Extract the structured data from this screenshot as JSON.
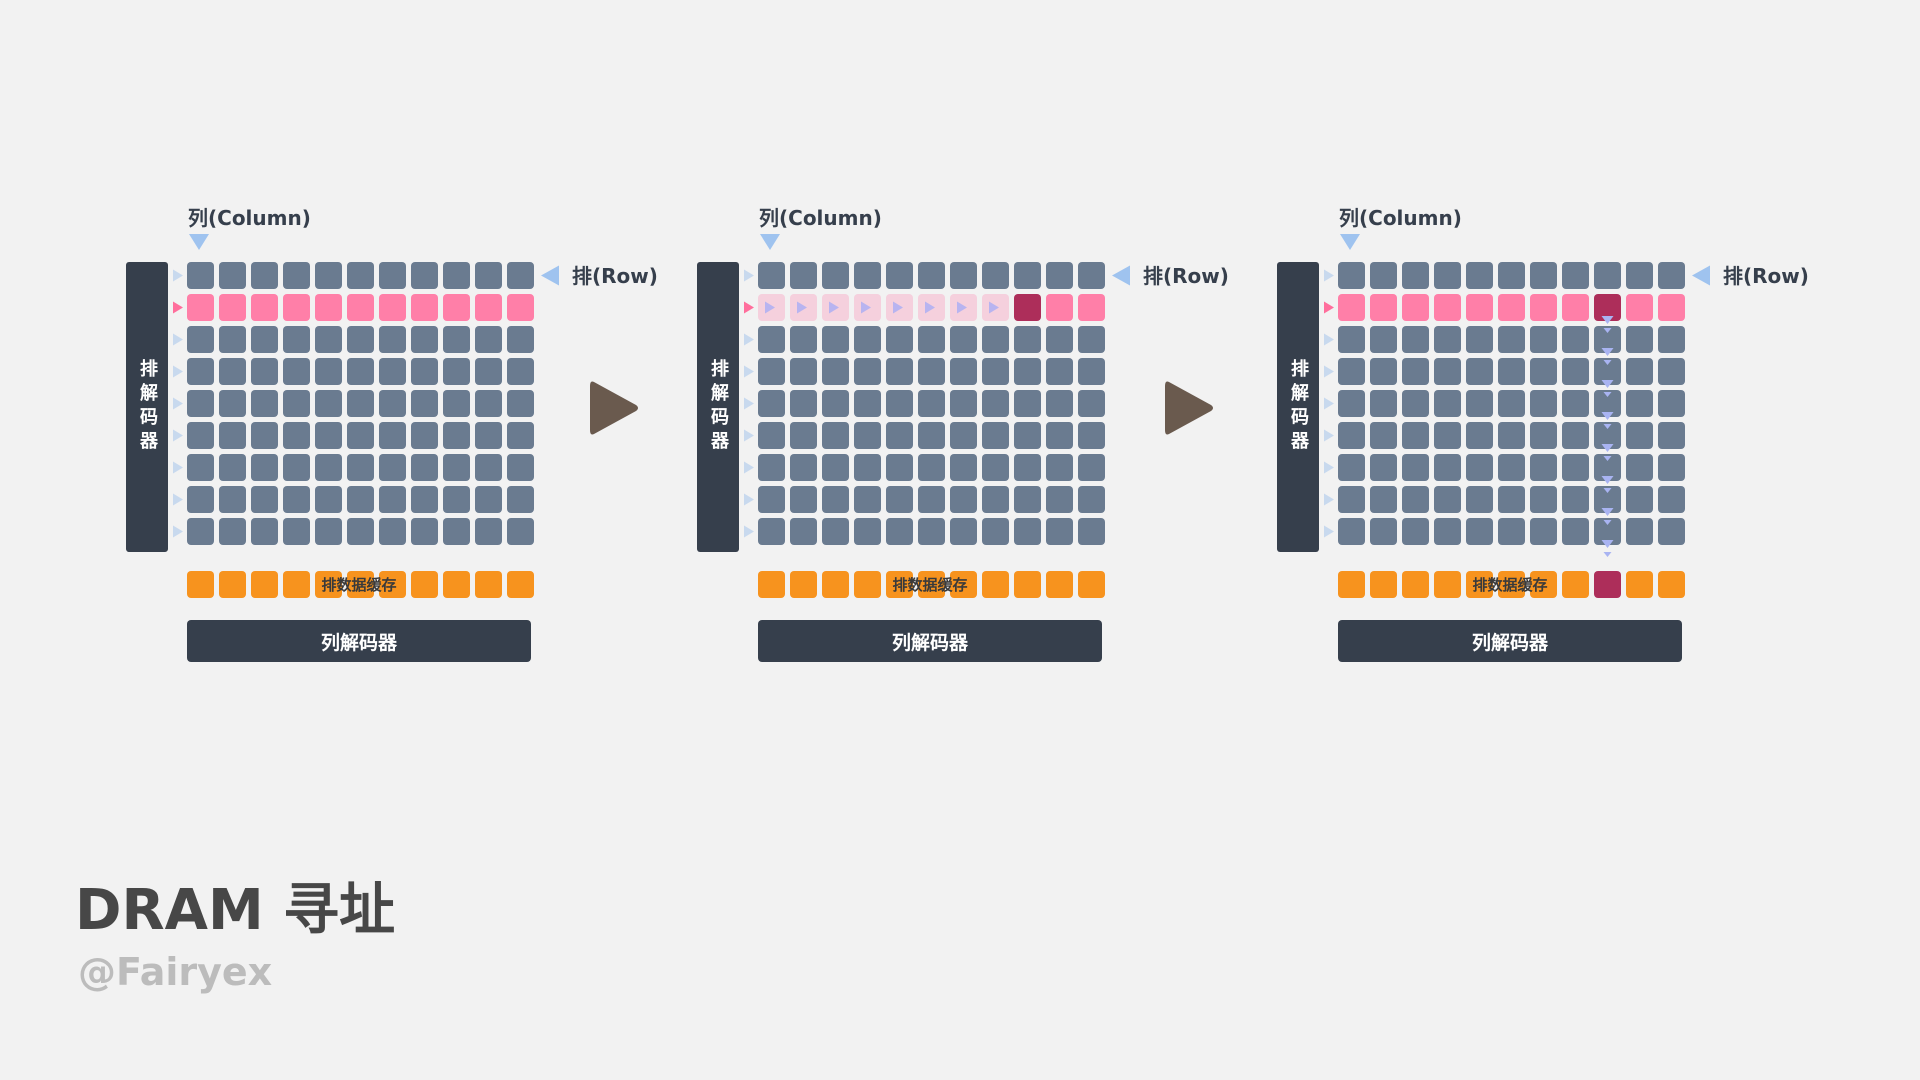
{
  "colors": {
    "background": "#f2f2f2",
    "cell_idle": "#6a7b90",
    "cell_active_row": "#ff7fa8",
    "cell_selected": "#ad2e5a",
    "buffer": "#f7931e",
    "decoder": "#363f4c",
    "col_pointer": "#9fc3ef",
    "row_pointer_idle": "#c8d9ee",
    "row_pointer_active": "#ff6e9c",
    "step_arrow": "#6a5a4e",
    "sense_arrow": "#a9b4f2",
    "faded_cell": "#f5d0dd"
  },
  "panels": [
    {
      "column_label": "列(Column)",
      "row_label": "排(Row)",
      "row_decoder_label": "排解码器",
      "column_decoder_label": "列解码器",
      "buffer_label": "排数据缓存",
      "active_row": 1,
      "state": "row-activated"
    },
    {
      "column_label": "列(Column)",
      "row_label": "排(Row)",
      "row_decoder_label": "排解码器",
      "column_decoder_label": "列解码器",
      "buffer_label": "排数据缓存",
      "active_row": 1,
      "selected_column": 8,
      "state": "column-scan"
    },
    {
      "column_label": "列(Column)",
      "row_label": "排(Row)",
      "row_decoder_label": "排解码器",
      "column_decoder_label": "列解码器",
      "buffer_label": "排数据缓存",
      "active_row": 1,
      "selected_column": 8,
      "state": "column-readout"
    }
  ],
  "step_arrows": [
    "step-arrow-1",
    "step-arrow-2"
  ],
  "title": "DRAM 寻址",
  "author": "@Fairyex"
}
